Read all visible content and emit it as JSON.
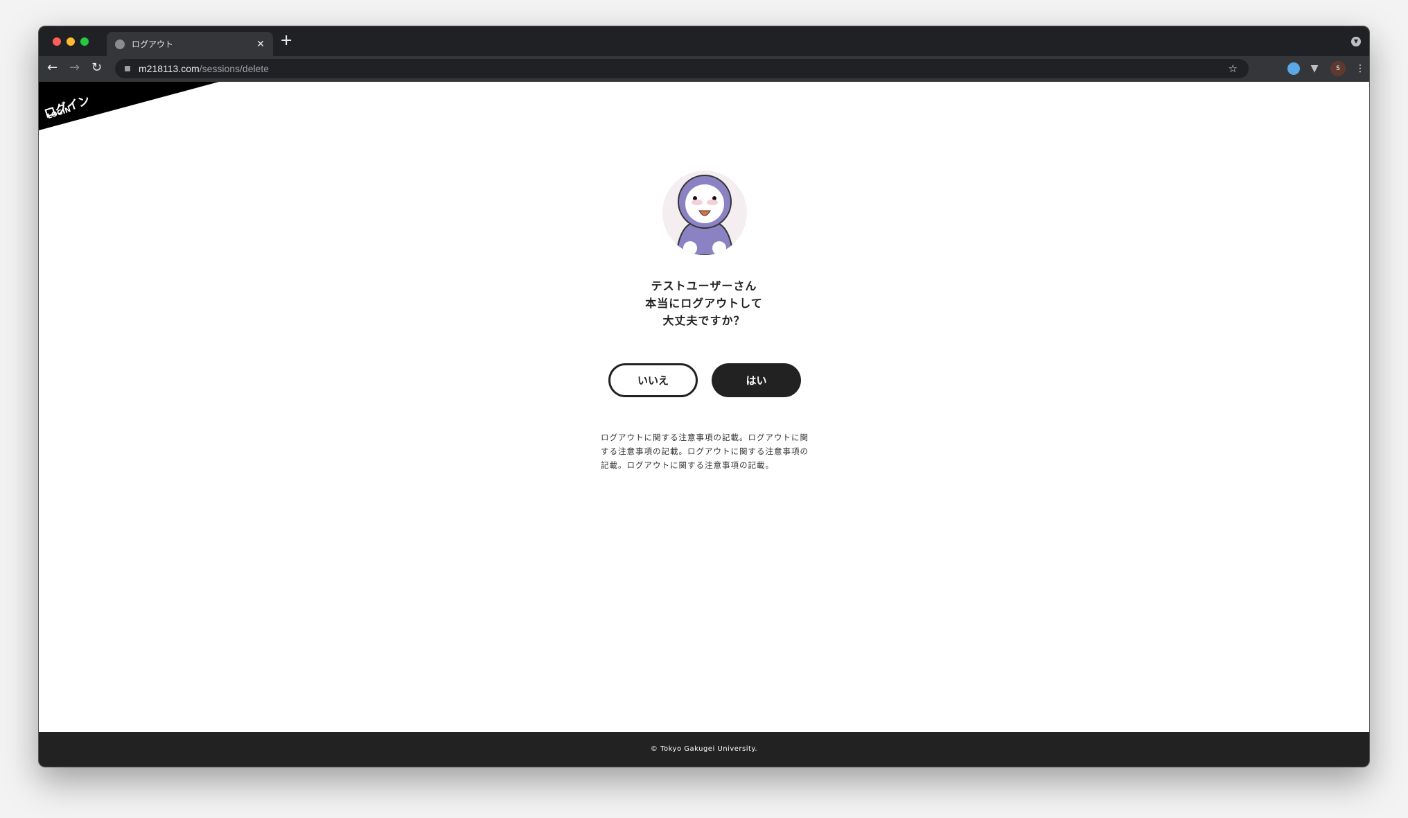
{
  "browser": {
    "tab_title": "ログアウト",
    "url_host": "m218113.com",
    "url_path": "/sessions/delete",
    "profile_initial": "S"
  },
  "corner": {
    "ja": "ログイン",
    "en": "LOGIN"
  },
  "dialog": {
    "lines": [
      "テストユーザーさん",
      "本当にログアウトして",
      "大丈夫ですか？"
    ],
    "no_label": "いいえ",
    "yes_label": "はい",
    "note": "ログアウトに関する注意事項の記載。ログアウトに関する注意事項の記載。ログアウトに関する注意事項の記載。ログアウトに関する注意事項の記載。"
  },
  "footer": {
    "copyright": "© Tokyo Gakugei University."
  }
}
